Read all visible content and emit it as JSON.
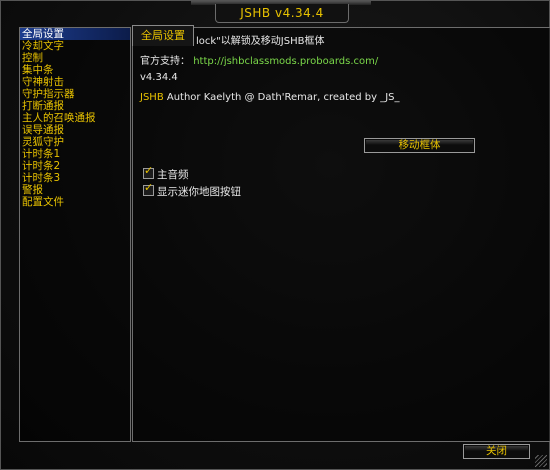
{
  "window": {
    "title": "JSHB v4.34.4"
  },
  "sidebar": {
    "items": [
      {
        "label": "全局设置",
        "active": true
      },
      {
        "label": "冷却文字"
      },
      {
        "label": "控制"
      },
      {
        "label": "集中条"
      },
      {
        "label": "守神射击"
      },
      {
        "label": "守护指示器"
      },
      {
        "label": "打断通报"
      },
      {
        "label": "主人的召唤通报"
      },
      {
        "label": "误导通报"
      },
      {
        "label": "灵狐守护"
      },
      {
        "label": "计时条1"
      },
      {
        "label": "计时条2"
      },
      {
        "label": "计时条3"
      },
      {
        "label": "警报"
      },
      {
        "label": "配置文件"
      }
    ]
  },
  "panel": {
    "tab_label": "全局设置",
    "line1": "lock\"以解锁及移动JSHB框体",
    "support_label": "官方支持：",
    "support_url": "http://jshbclassmods.proboards.com/",
    "version": "v4.34.4",
    "credit_prefix": "JSHB",
    "credit_text": " Author Kaelyth @ Dath'Remar, created by _JS_",
    "move_button": "移动框体",
    "checkboxes": [
      {
        "label": "主音频",
        "checked": true
      },
      {
        "label": "显示迷你地图按钮",
        "checked": true
      }
    ]
  },
  "footer": {
    "close_button": "关闭"
  },
  "colors": {
    "accent": "#e8c200",
    "link": "#7bd84a",
    "selected": "#1d3d8f"
  }
}
